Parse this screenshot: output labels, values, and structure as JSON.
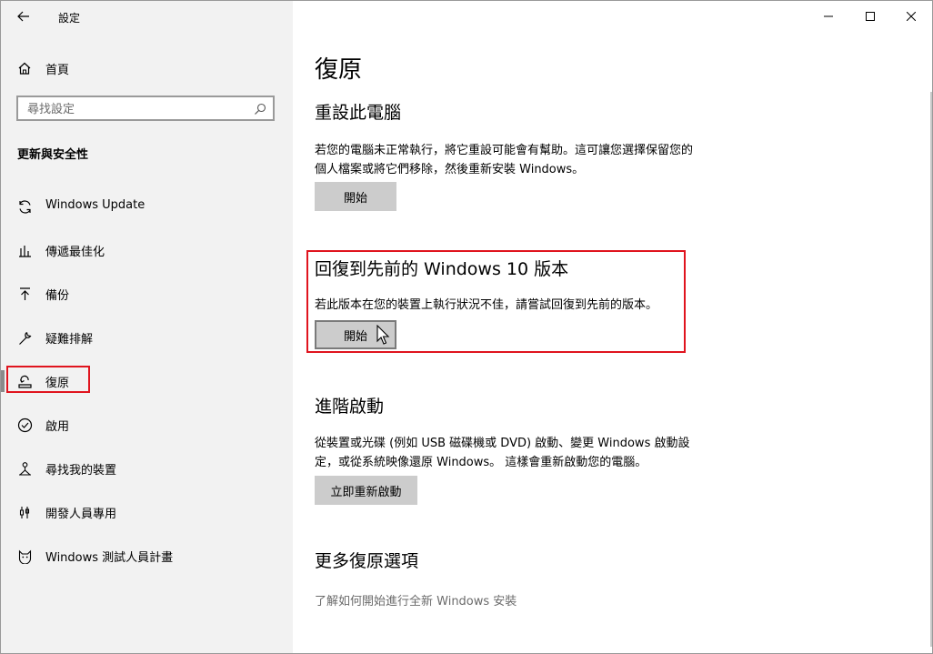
{
  "app": {
    "title": "設定"
  },
  "sidebar": {
    "home_label": "首頁",
    "search_placeholder": "尋找設定",
    "section_heading": "更新與安全性",
    "items": [
      {
        "label": "Windows Update",
        "icon": "sync-icon"
      },
      {
        "label": "傳遞最佳化",
        "icon": "delivery-optimization-icon"
      },
      {
        "label": "備份",
        "icon": "backup-upload-icon"
      },
      {
        "label": "疑難排解",
        "icon": "wrench-icon"
      },
      {
        "label": "復原",
        "icon": "recovery-icon",
        "selected": true
      },
      {
        "label": "啟用",
        "icon": "checkmark-circle-icon"
      },
      {
        "label": "尋找我的裝置",
        "icon": "find-device-icon"
      },
      {
        "label": "開發人員專用",
        "icon": "developer-tools-icon"
      },
      {
        "label": "Windows 測試人員計畫",
        "icon": "insider-cat-icon"
      }
    ]
  },
  "main": {
    "page_title": "復原",
    "reset": {
      "title": "重設此電腦",
      "desc_line1": "若您的電腦未正常執行，將它重設可能會有幫助。這可讓您選擇保留您的",
      "desc_line2": "個人檔案或將它們移除，然後重新安裝 Windows。",
      "button": "開始"
    },
    "rollback": {
      "title": "回復到先前的 Windows 10 版本",
      "desc": "若此版本在您的裝置上執行狀況不佳，請嘗試回復到先前的版本。",
      "button": "開始"
    },
    "advanced": {
      "title": "進階啟動",
      "desc_line1": "從裝置或光碟 (例如 USB 磁碟機或 DVD) 啟動、變更 Windows 啟動設",
      "desc_line2": "定，或從系統映像還原 Windows。 這樣會重新啟動您的電腦。",
      "button": "立即重新啟動"
    },
    "more": {
      "title": "更多復原選項",
      "link": "了解如何開始進行全新 Windows 安裝"
    }
  },
  "colors": {
    "highlight": "#e0141e",
    "sidebar_bg": "#f2f2f2",
    "button_bg": "#cccccc"
  }
}
